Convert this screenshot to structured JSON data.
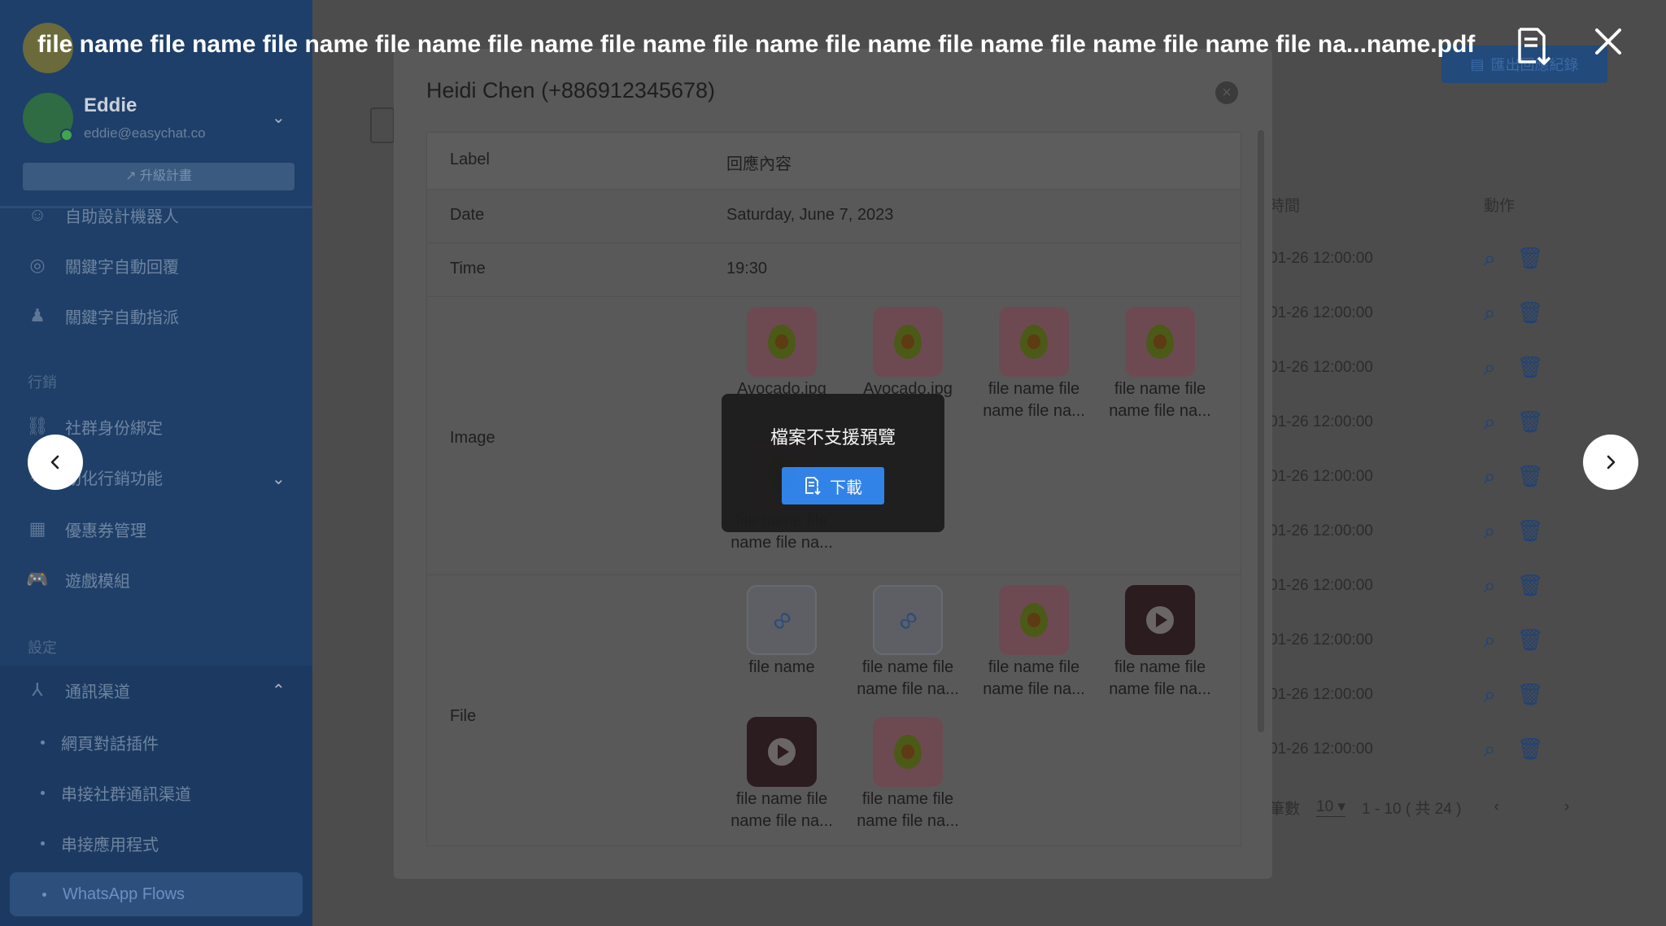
{
  "preview": {
    "file_title": "file name file name file name file name file name file name file name file name file name file name file name file na...name.pdf",
    "unsupported_message": "檔案不支援預覽",
    "download_label": "下載"
  },
  "sidebar": {
    "user_name": "Eddie",
    "user_email": "eddie@easychat.co",
    "upgrade_label": "升級計畫",
    "items": [
      {
        "label": "自助設計機器人"
      },
      {
        "label": "關鍵字自動回覆"
      },
      {
        "label": "關鍵字自動指派"
      }
    ],
    "section_marketing": "行銷",
    "marketing_items": [
      {
        "label": "社群身份綁定"
      },
      {
        "label": "動化行銷功能"
      },
      {
        "label": "優惠券管理"
      },
      {
        "label": "遊戲模組"
      }
    ],
    "section_settings": "設定",
    "channel_label": "通訊渠道",
    "channel_subitems": [
      {
        "label": "網頁對話插件"
      },
      {
        "label": "串接社群通訊渠道"
      },
      {
        "label": "串接應用程式"
      }
    ],
    "active_item": "WhatsApp Flows"
  },
  "background": {
    "export_label": "匯出回應紀錄",
    "col_time": "時間",
    "col_action": "動作",
    "row_time": "01-26 12:00:00",
    "rows_count_label": "筆數",
    "page_size": "10",
    "range_text": "1 - 10 ( 共 24 )"
  },
  "modal": {
    "title": "Heidi Chen (+886912345678)",
    "header_label": "Label",
    "header_value": "回應內容",
    "date_label": "Date",
    "date_value": "Saturday, June 7, 2023",
    "time_label": "Time",
    "time_value": "19:30",
    "image_label": "Image",
    "file_label": "File",
    "images": [
      {
        "name_line1": "Avocado.jpg",
        "name_line2": ""
      },
      {
        "name_line1": "Avocado.jpg",
        "name_line2": ""
      },
      {
        "name_line1": "file name file",
        "name_line2": "name file na..."
      },
      {
        "name_line1": "file name file",
        "name_line2": "name file na..."
      },
      {
        "name_line1": "file name file",
        "name_line2": "name file na..."
      }
    ],
    "files": [
      {
        "name_line1": "file name",
        "name_line2": "",
        "kind": "clip"
      },
      {
        "name_line1": "file name file",
        "name_line2": "name file na...",
        "kind": "clip"
      },
      {
        "name_line1": "file name file",
        "name_line2": "name file na...",
        "kind": "image"
      },
      {
        "name_line1": "file name file",
        "name_line2": "name file na...",
        "kind": "video"
      },
      {
        "name_line1": "file name file",
        "name_line2": "name file na...",
        "kind": "video"
      },
      {
        "name_line1": "file name file",
        "name_line2": "name file na...",
        "kind": "image"
      }
    ]
  },
  "icons": {
    "prev": "chevron-left-icon",
    "next": "chevron-right-icon",
    "close": "close-icon",
    "download": "file-download-icon"
  },
  "colors": {
    "accent": "#2f86f0",
    "sidebar": "#1f3f68"
  }
}
